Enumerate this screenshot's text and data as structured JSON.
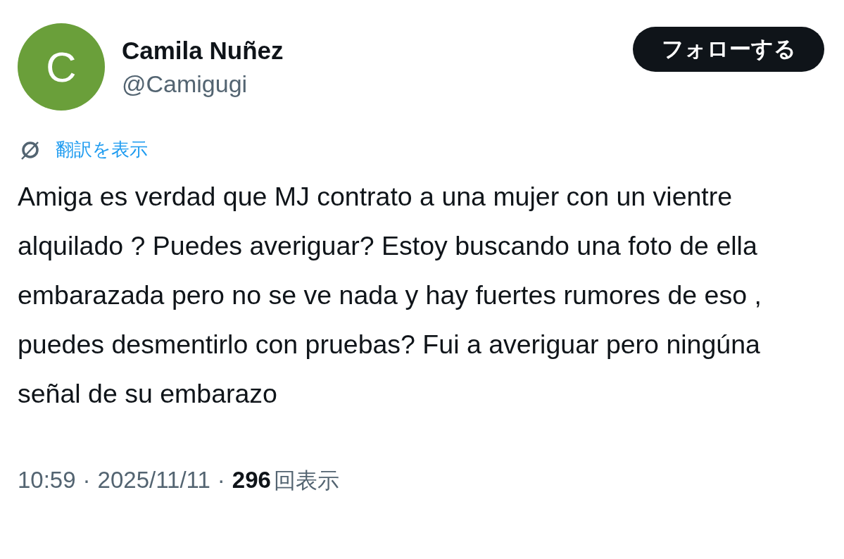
{
  "author": {
    "avatar_letter": "C",
    "name": "Camila Nuñez",
    "handle": "@Camigugi"
  },
  "follow_button": {
    "label": "フォローする"
  },
  "translate_link": {
    "label": "翻訳を表示"
  },
  "tweet": {
    "text": "Amiga es verdad que MJ contrato a una mujer con un vientre alquilado ? Puedes averiguar? Estoy buscando una foto de ella embarazada pero no se ve nada y hay fuertes rumores de eso , puedes desmentirlo con pruebas? Fui a averiguar pero ningúna señal de su embarazo"
  },
  "meta": {
    "time": "10:59",
    "separator": "·",
    "date": "2025/11/11",
    "views_count": "296",
    "views_label": "回表示"
  }
}
